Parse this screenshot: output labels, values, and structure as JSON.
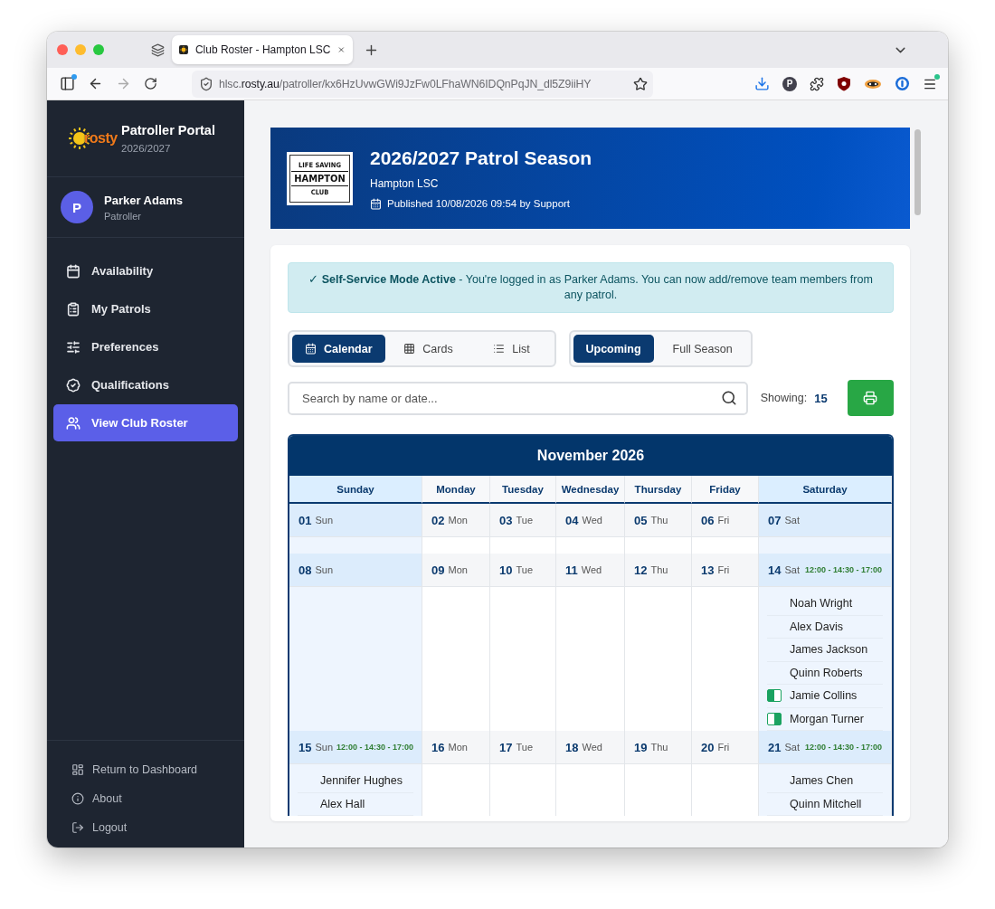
{
  "browser": {
    "tab": {
      "title": "Club Roster - Hampton LSC"
    },
    "url": {
      "host_prefix": "hlsc.",
      "host_domain": "rosty.au",
      "path": "/patroller/kx6HzUvwGWi9JzFw0LFhaWN6IDQnPqJN_dl5Z9iiHY"
    },
    "profile_badge": "P"
  },
  "sidebar": {
    "logo_text": "rosty",
    "title": "Patroller Portal",
    "season": "2026/2027",
    "user": {
      "initial": "P",
      "name": "Parker Adams",
      "role": "Patroller"
    },
    "items": [
      {
        "label": "Availability",
        "selected": false
      },
      {
        "label": "My Patrols",
        "selected": false
      },
      {
        "label": "Preferences",
        "selected": false
      },
      {
        "label": "Qualifications",
        "selected": false
      },
      {
        "label": "View Club Roster",
        "selected": true
      }
    ],
    "footer_items": [
      "Return to Dashboard",
      "About",
      "Logout"
    ]
  },
  "header": {
    "logo": {
      "top": "LIFE SAVING",
      "name": "HAMPTON",
      "bottom": "CLUB"
    },
    "title": "2026/2027 Patrol Season",
    "club": "Hampton LSC",
    "published": "Published 10/08/2026 09:54 by Support"
  },
  "alert": "✓ **Self-Service Mode Active** - You're logged in as Parker Adams. You can now add/remove team members from any patrol.",
  "view_modes": [
    {
      "label": "Calendar",
      "selected": true
    },
    {
      "label": "Cards",
      "selected": false
    },
    {
      "label": "List",
      "selected": false
    }
  ],
  "ranges": [
    {
      "label": "Upcoming",
      "selected": true
    },
    {
      "label": "Full Season",
      "selected": false
    }
  ],
  "search": {
    "placeholder": "Search by name or date..."
  },
  "showing": {
    "label": "Showing:",
    "count": "15"
  },
  "calendar": {
    "title": "November 2026",
    "columns": [
      {
        "label": "Sunday",
        "weekend": true
      },
      {
        "label": "Monday",
        "weekend": false
      },
      {
        "label": "Tuesday",
        "weekend": false
      },
      {
        "label": "Wednesday",
        "weekend": false
      },
      {
        "label": "Thursday",
        "weekend": false
      },
      {
        "label": "Friday",
        "weekend": false
      },
      {
        "label": "Saturday",
        "weekend": true
      }
    ],
    "weeks": [
      {
        "days": [
          {
            "date": "01",
            "weekday": "Sun"
          },
          {
            "date": "02",
            "weekday": "Mon"
          },
          {
            "date": "03",
            "weekday": "Tue"
          },
          {
            "date": "04",
            "weekday": "Wed"
          },
          {
            "date": "05",
            "weekday": "Thu"
          },
          {
            "date": "06",
            "weekday": "Fri"
          },
          {
            "date": "07",
            "weekday": "Sat"
          }
        ]
      },
      {
        "days": [
          {
            "date": "08",
            "weekday": "Sun"
          },
          {
            "date": "09",
            "weekday": "Mon"
          },
          {
            "date": "10",
            "weekday": "Tue"
          },
          {
            "date": "11",
            "weekday": "Wed"
          },
          {
            "date": "12",
            "weekday": "Thu"
          },
          {
            "date": "13",
            "weekday": "Fri"
          },
          {
            "date": "14",
            "weekday": "Sat",
            "times": "12:00 - 14:30 - 17:00",
            "members": [
              {
                "name": "Noah Wright",
                "kind": "plain"
              },
              {
                "name": "Alex Davis",
                "kind": "plain"
              },
              {
                "name": "James Jackson",
                "kind": "plain"
              },
              {
                "name": "Quinn Roberts",
                "kind": "plain"
              },
              {
                "name": "Jamie Collins",
                "kind": "first-half"
              },
              {
                "name": "Morgan Turner",
                "kind": "second-half"
              }
            ]
          }
        ]
      },
      {
        "days": [
          {
            "date": "15",
            "weekday": "Sun",
            "times": "12:00 - 14:30 - 17:00",
            "members": [
              {
                "name": "Jennifer Hughes",
                "kind": "plain"
              },
              {
                "name": "Alex Hall",
                "kind": "plain"
              }
            ]
          },
          {
            "date": "16",
            "weekday": "Mon"
          },
          {
            "date": "17",
            "weekday": "Tue"
          },
          {
            "date": "18",
            "weekday": "Wed"
          },
          {
            "date": "19",
            "weekday": "Thu"
          },
          {
            "date": "20",
            "weekday": "Fri"
          },
          {
            "date": "21",
            "weekday": "Sat",
            "times": "12:00 - 14:30 - 17:00",
            "members": [
              {
                "name": "James Chen",
                "kind": "plain"
              },
              {
                "name": "Quinn Mitchell",
                "kind": "plain"
              }
            ]
          }
        ]
      }
    ]
  }
}
